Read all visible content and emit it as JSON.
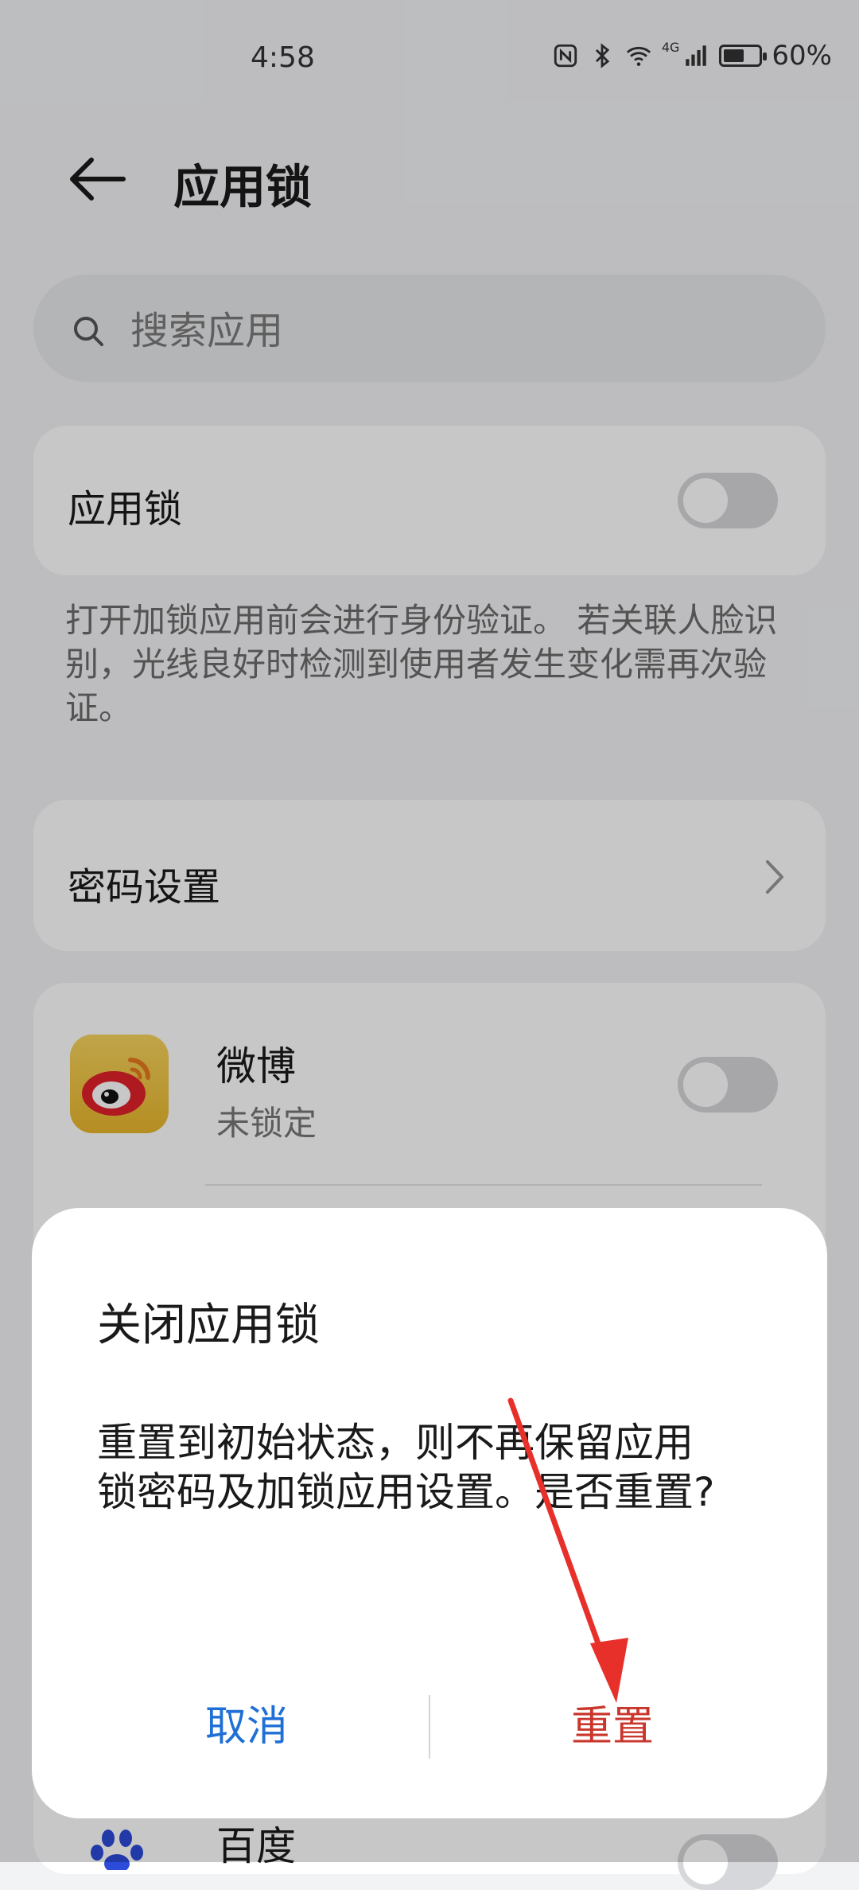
{
  "status_bar": {
    "time": "4:58",
    "network_label": "4G",
    "battery_percent": "60%",
    "battery_level": 0.6
  },
  "header": {
    "title": "应用锁"
  },
  "search": {
    "placeholder": "搜索应用"
  },
  "app_lock": {
    "label": "应用锁",
    "enabled": false,
    "description": "打开加锁应用前会进行身份验证。 若关联人脸识别，光线良好时检测到使用者发生变化需再次验证。"
  },
  "password_settings": {
    "label": "密码设置"
  },
  "apps": [
    {
      "name": "微博",
      "status": "未锁定",
      "locked": false
    },
    {
      "name": "百度",
      "locked": false
    }
  ],
  "dialog": {
    "title": "关闭应用锁",
    "message": "重置到初始状态，则不再保留应用锁密码及加锁应用设置。是否重置?",
    "cancel_label": "取消",
    "confirm_label": "重置"
  },
  "colors": {
    "accent_blue": "#1f6fd6",
    "danger_red": "#c9362c",
    "annotation_arrow": "#e8302b"
  }
}
